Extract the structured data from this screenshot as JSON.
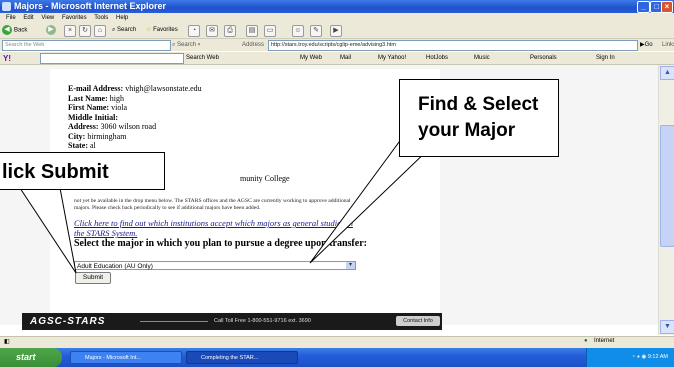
{
  "window": {
    "title": "Majors - Microsoft Internet Explorer"
  },
  "menu": [
    "File",
    "Edit",
    "View",
    "Favorites",
    "Tools",
    "Help"
  ],
  "toolbar": {
    "back": "Back",
    "search": "Search",
    "favorites": "Favorites"
  },
  "address": {
    "search_web_label": "Search the Web",
    "search_btn": "Search",
    "label": "Address",
    "url": "http://stars.troy.edu/scripts/cglip-eme/advising3.htm",
    "go": "Go",
    "links": "Links"
  },
  "yahoo_bar": {
    "search_web": "Search Web",
    "my_web": "My Web",
    "mail": "Mail",
    "my_yahoo": "My Yahoo!",
    "hotjobs": "HotJobs",
    "music": "Music",
    "personals": "Personals",
    "sign_in": "Sign In"
  },
  "student": {
    "email_label": "E-mail Address:",
    "email": "vhigh@lawsonstate.edu",
    "last_label": "Last Name:",
    "last": "high",
    "first_label": "First Name:",
    "first": "viola",
    "middle_label": "Middle Initial:",
    "middle": "",
    "address_label": "Address:",
    "address": "3060 wilson road",
    "city_label": "City:",
    "city": "birmingham",
    "state_label": "State:",
    "state": "al",
    "college": "munity College"
  },
  "notice": "not yet be available in the drop menu below. The STARS offices and the AGSC are currently working to approve additional majors. Please check back periodically to see if additional majors have been added.",
  "link_text": "Click here to find out which institutions accept which majors as general studies in the STARS System.",
  "prompt": "Select the major in which you plan to pursue a degree upon transfer:",
  "major_select": {
    "selected": "Adult Education (AU Only)"
  },
  "submit_label": "Submit",
  "footer": {
    "logo": "AGSC-STARS",
    "phone": "Call Toll Free 1-800-551-9716 ext. 3690",
    "contact": "Contact Info"
  },
  "status": {
    "zone": "Internet"
  },
  "taskbar": {
    "start": "start",
    "tasks": [
      "Majors - Microsoft Int...",
      "Completing the STAR..."
    ],
    "clock": "9:12 AM"
  },
  "callouts": {
    "find": "Find & Select your Major",
    "submit": "lick Submit"
  }
}
